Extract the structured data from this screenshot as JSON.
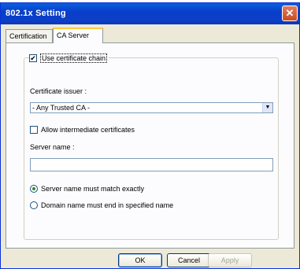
{
  "window": {
    "title": "802.1x Setting",
    "close_glyph": "✕"
  },
  "tabs": [
    {
      "label": "Certification",
      "active": false
    },
    {
      "label": "CA Server",
      "active": true
    }
  ],
  "form": {
    "use_chain_label": "Use certificate chain",
    "use_chain_checked": true,
    "issuer_label": "Certificate issuer :",
    "issuer_value": "- Any Trusted CA -",
    "allow_intermediate_label": "Allow intermediate certificates",
    "allow_intermediate_checked": false,
    "server_name_label": "Server name :",
    "server_name_value": "",
    "radio_exact_label": "Server name must match exactly",
    "radio_exact_selected": true,
    "radio_domain_label": "Domain name must end in specified name",
    "radio_domain_selected": false
  },
  "buttons": {
    "ok": "OK",
    "cancel": "Cancel",
    "apply": "Apply"
  },
  "icons": {
    "close": "close-icon",
    "dropdown": "chevron-down-icon"
  },
  "colors": {
    "titlebar": "#0a5fe0",
    "close_button": "#c94b27",
    "dialog_bg": "#ece9d8"
  }
}
